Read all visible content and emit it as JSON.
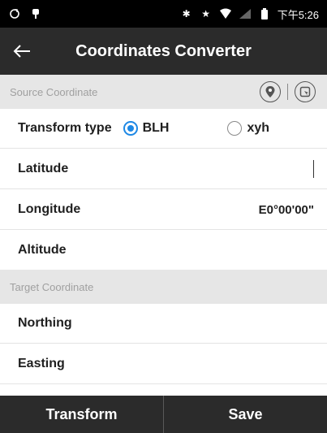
{
  "status_bar": {
    "left_icons": [
      "sync-icon",
      "usb-icon"
    ],
    "right_icons": [
      "bluetooth-icon",
      "star-icon",
      "wifi-icon",
      "signal-icon",
      "battery-icon"
    ],
    "time": "下午5:26"
  },
  "app_bar": {
    "title": "Coordinates Converter"
  },
  "source_section": {
    "title": "Source Coordinate"
  },
  "transform_type": {
    "label": "Transform type",
    "options": [
      {
        "label": "BLH",
        "selected": true
      },
      {
        "label": "xyh",
        "selected": false
      }
    ]
  },
  "fields": {
    "latitude": {
      "label": "Latitude",
      "value": ""
    },
    "longitude": {
      "label": "Longitude",
      "value": "E0°00'00\""
    },
    "altitude": {
      "label": "Altitude",
      "value": ""
    }
  },
  "target_section": {
    "title": "Target Coordinate"
  },
  "target_fields": {
    "northing": {
      "label": "Northing",
      "value": ""
    },
    "easting": {
      "label": "Easting",
      "value": ""
    }
  },
  "actions": {
    "transform_label": "Transform",
    "save_label": "Save"
  },
  "colors": {
    "accent": "#1e88e5",
    "app_bar": "#2b2b2b",
    "section_bg": "#e6e6e6"
  }
}
